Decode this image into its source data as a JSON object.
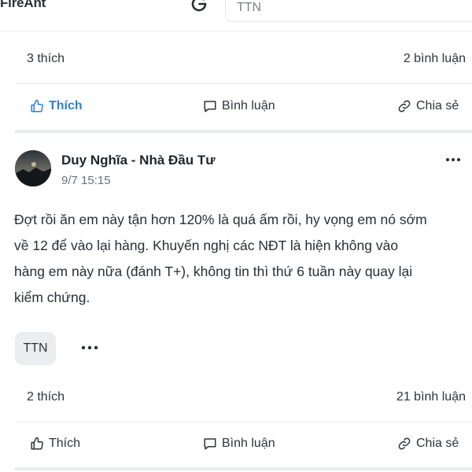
{
  "header": {
    "brand": "FireAnt",
    "search_value": "TTN"
  },
  "prev_post": {
    "likes": "3 thích",
    "comments": "2 bình luận",
    "like_label": "Thích",
    "comment_label": "Bình luận",
    "share_label": "Chia sẻ"
  },
  "post": {
    "author": "Duy Nghĩa - Nhà Đầu Tư",
    "time": "9/7 15:15",
    "body_lines": [
      "Đợt rồi ăn em này tận hơn 120% là quá ấm rồi, hy vọng em nó sớm",
      "về 12 để vào lại hàng. Khuyến nghị các NĐT là hiện không vào",
      "hàng em này nữa (đánh T+), không tin thì thứ 6 tuần này quay lại",
      "kiểm chứng."
    ],
    "tag": "TTN",
    "likes": "2 thích",
    "comments": "21 bình luận",
    "like_label": "Thích",
    "comment_label": "Bình luận",
    "share_label": "Chia sẻ"
  },
  "colors": {
    "liked_accent": "#2f7fd8",
    "text": "#2f3338",
    "divider": "#e8eaed"
  },
  "icons": {
    "like": "thumbs-up-icon",
    "comment": "comment-icon",
    "share": "link-icon",
    "more": "more-horizontal-icon",
    "google": "google-icon"
  }
}
